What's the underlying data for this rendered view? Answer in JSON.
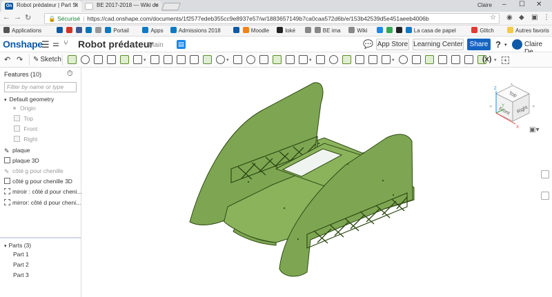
{
  "browser": {
    "tabs": [
      {
        "title": "Robot prédateur | Part St",
        "favicon": "On"
      },
      {
        "title": "BE 2017-2018 — Wiki de",
        "favicon": ""
      }
    ],
    "window_user": "Claire",
    "url": {
      "secure_label": "Sécurisé",
      "address": "https://cad.onshape.com/documents/1f2577edeb355cc9e8937e57/w/1883657149b7ca0caa572d6b/e/153b42539d5e451aeeb4006b"
    },
    "bookmarks": [
      {
        "label": "Applications",
        "icon": "apps-grid-icon",
        "color": "#555555"
      },
      {
        "label": "",
        "icon": "onshape-icon",
        "color": "#0e5aa7"
      },
      {
        "label": "",
        "icon": "maps-icon",
        "color": "#d93025"
      },
      {
        "label": "",
        "icon": "facebook-icon",
        "color": "#3b5998"
      },
      {
        "label": "",
        "icon": "linkedin-icon",
        "color": "#0077b5"
      },
      {
        "label": "",
        "icon": "star-icon",
        "color": "#999999"
      },
      {
        "label": "Portail",
        "icon": "globe-icon",
        "color": "#0e7ac4"
      },
      {
        "label": "Apps",
        "icon": "globe-icon",
        "color": "#0e7ac4"
      },
      {
        "label": "Admissions 2018",
        "icon": "globe-icon",
        "color": "#0e7ac4"
      },
      {
        "label": "",
        "icon": "onshape-icon",
        "color": "#0e5aa7"
      },
      {
        "label": "Moodle",
        "icon": "moodle-icon",
        "color": "#f98012"
      },
      {
        "label": "loké",
        "icon": "l-icon",
        "color": "#222222"
      },
      {
        "label": "",
        "icon": "doc-icon",
        "color": "#888888"
      },
      {
        "label": "BE ima",
        "icon": "doc-icon",
        "color": "#888888"
      },
      {
        "label": "Wiki",
        "icon": "doc-icon",
        "color": "#888888"
      },
      {
        "label": "",
        "icon": "c-icon",
        "color": "#1e88e5"
      },
      {
        "label": "",
        "icon": "g-icon",
        "color": "#34a853"
      },
      {
        "label": "",
        "icon": "plus-icon",
        "color": "#222222"
      },
      {
        "label": "La casa de papel",
        "icon": "globe-icon",
        "color": "#0e7ac4"
      },
      {
        "label": "Glitch",
        "icon": "video-icon",
        "color": "#e53935"
      }
    ],
    "other_bookmarks": "Autres favoris"
  },
  "header": {
    "logo": "Onshape",
    "title": "Robot prédateur",
    "branch": "Main",
    "app_store": "App Store",
    "learning_center": "Learning Center",
    "share": "Share",
    "help": "?",
    "user": "Claire De"
  },
  "toolbar": {
    "sketch": "Sketch",
    "variable": "(x)"
  },
  "features": {
    "heading": "Features (10)",
    "filter_placeholder": "Filter by name or type",
    "default_geometry": "Default geometry",
    "planes": [
      "Origin",
      "Top",
      "Front",
      "Right"
    ],
    "items": [
      {
        "label": "plaque",
        "icon": "sketch-icon",
        "suppressed": false
      },
      {
        "label": "plaque 3D",
        "icon": "extrude-icon",
        "suppressed": false
      },
      {
        "label": "côté g pour chenille",
        "icon": "sketch-icon",
        "suppressed": true
      },
      {
        "label": "côté g pour chenille 3D",
        "icon": "extrude-icon",
        "suppressed": false
      },
      {
        "label": "miroir : côté d pour cheni...",
        "icon": "mirror-icon",
        "suppressed": false
      },
      {
        "label": "mirror: côté d pour cheni...",
        "icon": "mirror-icon",
        "suppressed": false
      }
    ]
  },
  "parts": {
    "heading": "Parts (3)",
    "items": [
      "Part 1",
      "Part 2",
      "Part 3"
    ]
  },
  "viewcube": {
    "faces": [
      "Top",
      "Front",
      "Right"
    ],
    "axes": [
      "Z",
      "Y",
      "X"
    ]
  },
  "colors": {
    "part_face": "#7ea652",
    "part_top": "#8ab35c",
    "part_edge": "#2e4a14",
    "accent": "#1565c0"
  }
}
